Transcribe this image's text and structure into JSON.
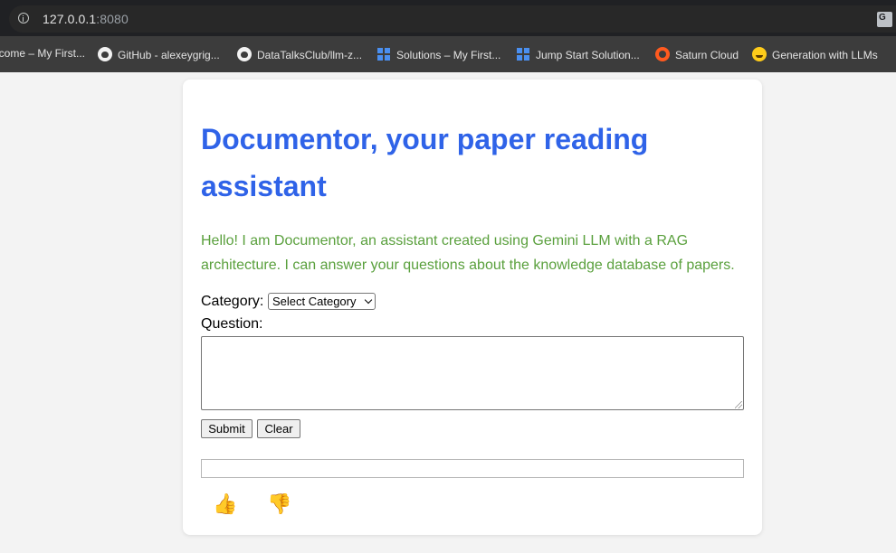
{
  "browser": {
    "url_host": "127.0.0.1",
    "url_port": ":8080",
    "bookmarks": [
      {
        "label": "lcome – My First...",
        "icon": "grid-icon"
      },
      {
        "label": "GitHub - alexeygrig...",
        "icon": "github-icon"
      },
      {
        "label": "DataTalksClub/llm-z...",
        "icon": "github-icon"
      },
      {
        "label": "Solutions – My First...",
        "icon": "grid-icon"
      },
      {
        "label": "Jump Start Solution...",
        "icon": "grid-icon"
      },
      {
        "label": "Saturn Cloud",
        "icon": "saturn-icon"
      },
      {
        "label": "Generation with LLMs",
        "icon": "huggingface-icon"
      }
    ]
  },
  "page": {
    "title": "Documentor, your paper reading assistant",
    "intro": "Hello! I am Documentor, an assistant created using Gemini LLM with a RAG architecture. I can answer your questions about the knowledge database of papers.",
    "category_label": "Category:",
    "category_selected": "Select Category",
    "question_label": "Question:",
    "question_value": "",
    "submit_label": "Submit",
    "clear_label": "Clear",
    "answer_value": "",
    "thumbs_up": "👍",
    "thumbs_down": "👎"
  },
  "colors": {
    "title": "#2f63e8",
    "intro": "#5aa03d"
  }
}
